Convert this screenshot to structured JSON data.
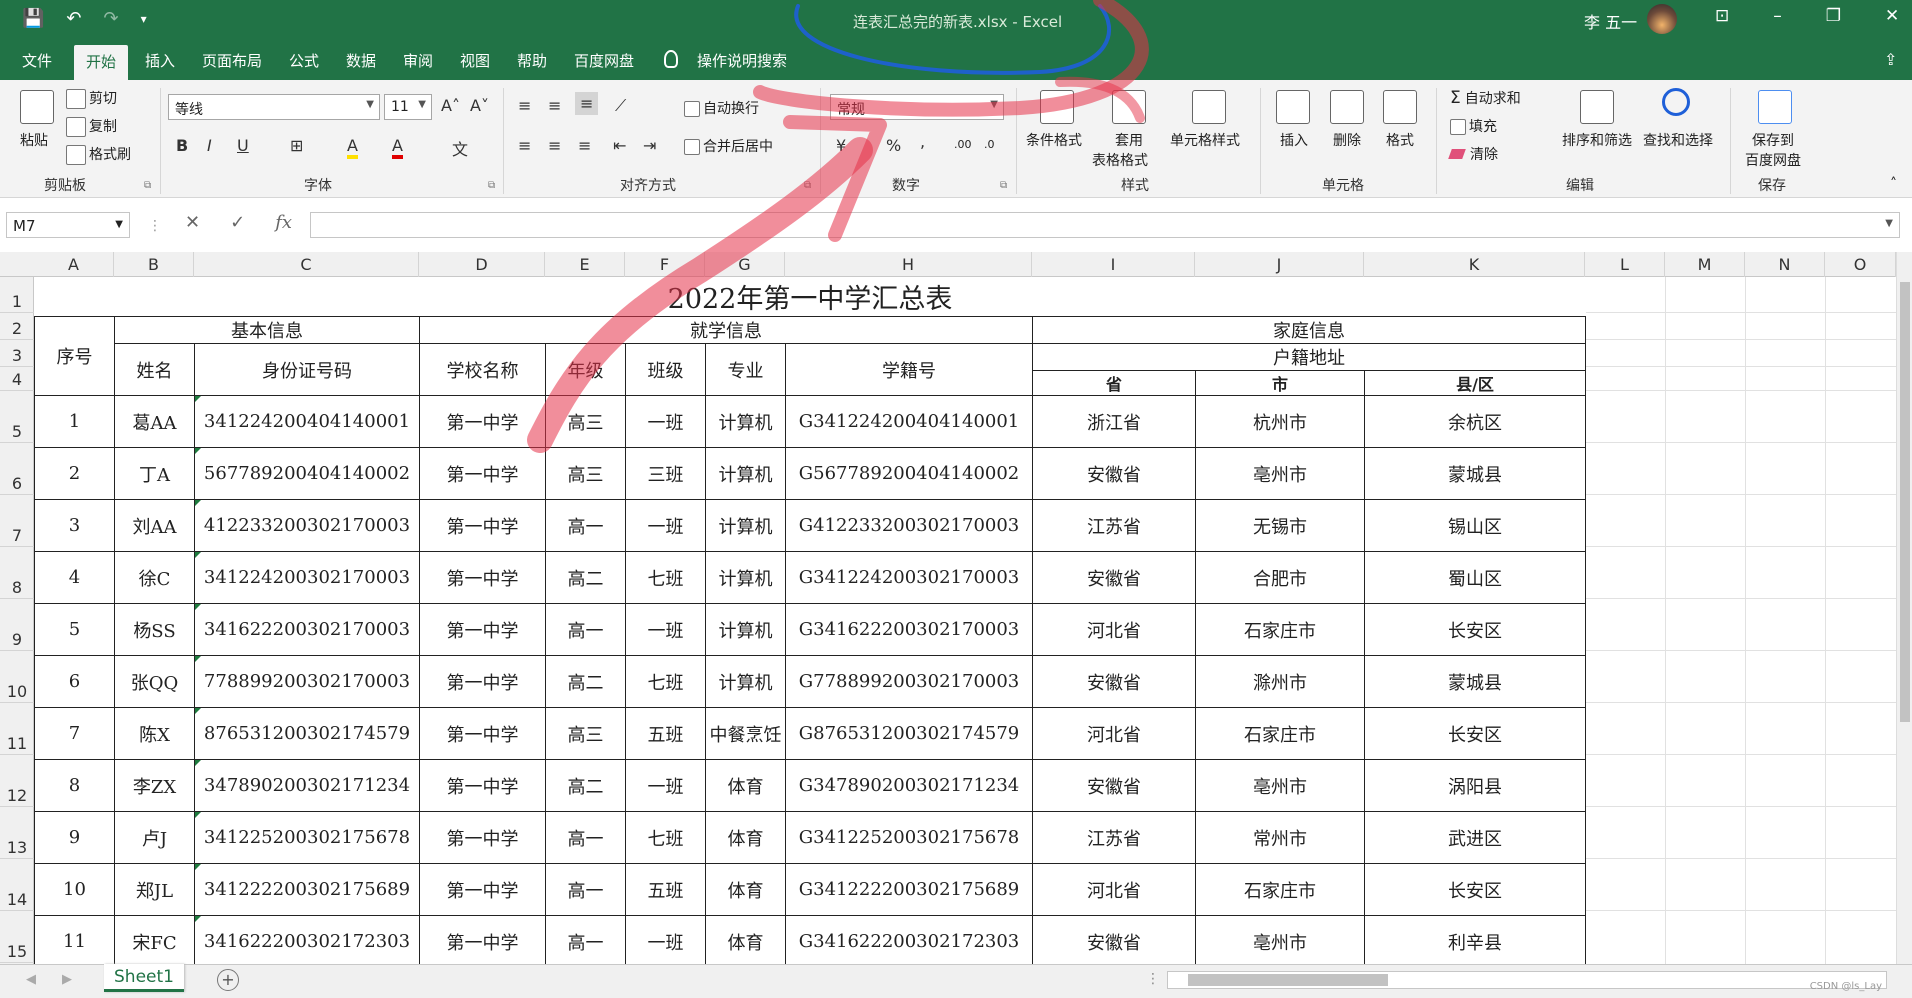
{
  "titlebar": {
    "qat": [
      "💾",
      "↶",
      "↷",
      "▾"
    ],
    "document_title": "连表汇总完的新表.xlsx - Excel",
    "user_name": "李 五一",
    "win_buttons": [
      "⊡",
      "–",
      "❐",
      "✕"
    ]
  },
  "ribbon_tabs": [
    "文件",
    "开始",
    "插入",
    "页面布局",
    "公式",
    "数据",
    "审阅",
    "视图",
    "帮助",
    "百度网盘"
  ],
  "active_tab": "开始",
  "search_hint": "操作说明搜索",
  "share_label": "⇪",
  "clipboard": {
    "paste": "粘贴",
    "cut": "剪切",
    "copy": "复制",
    "format_painter": "格式刷",
    "label": "剪贴板"
  },
  "font": {
    "name": "等线",
    "size": "11",
    "grow": "A˄",
    "shrink": "A˅",
    "bold": "B",
    "italic": "I",
    "underline": "U",
    "border": "⊞",
    "fill": "A",
    "color": "A",
    "wen": "文",
    "label": "字体"
  },
  "alignment": {
    "wrap": "自动换行",
    "merge": "合并后居中",
    "label": "对齐方式"
  },
  "number": {
    "format": "常规",
    "percent": "%",
    "comma": ",",
    "inc": ".00",
    "dec": ".0",
    "label": "数字"
  },
  "styles": {
    "conditional": "条件格式",
    "table_fmt_1": "套用",
    "table_fmt_2": "表格格式",
    "cell_styles": "单元格样式",
    "label": "样式"
  },
  "cells": {
    "insert": "插入",
    "delete": "删除",
    "format": "格式",
    "label": "单元格"
  },
  "editing": {
    "autosum": "自动求和",
    "fill": "填充",
    "clear": "清除",
    "sort": "排序和筛选",
    "find": "查找和选择",
    "label": "编辑"
  },
  "save": {
    "line1": "保存到",
    "line2": "百度网盘",
    "label": "保存"
  },
  "formula_bar": {
    "name_box": "M7",
    "fx": "fx",
    "cancel": "✕",
    "confirm": "✓",
    "content": ""
  },
  "columns": [
    "A",
    "B",
    "C",
    "D",
    "E",
    "F",
    "G",
    "H",
    "I",
    "J",
    "K",
    "L",
    "M",
    "N",
    "O"
  ],
  "rows": [
    "1",
    "2",
    "3",
    "4",
    "5",
    "6",
    "7",
    "8",
    "9",
    "10",
    "11",
    "12",
    "13",
    "14",
    "15"
  ],
  "sheet": {
    "title": "2022年第一中学汇总表",
    "group_basic": "基本信息",
    "group_school": "就学信息",
    "group_family": "家庭信息",
    "col_index": "序号",
    "col_name": "姓名",
    "col_id": "身份证号码",
    "col_school": "学校名称",
    "col_grade": "年级",
    "col_class": "班级",
    "col_major": "专业",
    "col_studentno": "学籍号",
    "col_hukou": "户籍地址",
    "col_province": "省",
    "col_city": "市",
    "col_county": "县/区",
    "records": [
      [
        "1",
        "葛AA",
        "341224200404140001",
        "第一中学",
        "高三",
        "一班",
        "计算机",
        "G341224200404140001",
        "浙江省",
        "杭州市",
        "余杭区"
      ],
      [
        "2",
        "丁A",
        "567789200404140002",
        "第一中学",
        "高三",
        "三班",
        "计算机",
        "G567789200404140002",
        "安徽省",
        "亳州市",
        "蒙城县"
      ],
      [
        "3",
        "刘AA",
        "412233200302170003",
        "第一中学",
        "高一",
        "一班",
        "计算机",
        "G412233200302170003",
        "江苏省",
        "无锡市",
        "锡山区"
      ],
      [
        "4",
        "徐C",
        "341224200302170003",
        "第一中学",
        "高二",
        "七班",
        "计算机",
        "G341224200302170003",
        "安徽省",
        "合肥市",
        "蜀山区"
      ],
      [
        "5",
        "杨SS",
        "341622200302170003",
        "第一中学",
        "高一",
        "一班",
        "计算机",
        "G341622200302170003",
        "河北省",
        "石家庄市",
        "长安区"
      ],
      [
        "6",
        "张QQ",
        "778899200302170003",
        "第一中学",
        "高二",
        "七班",
        "计算机",
        "G778899200302170003",
        "安徽省",
        "滁州市",
        "蒙城县"
      ],
      [
        "7",
        "陈X",
        "876531200302174579",
        "第一中学",
        "高三",
        "五班",
        "中餐烹饪",
        "G876531200302174579",
        "河北省",
        "石家庄市",
        "长安区"
      ],
      [
        "8",
        "李ZX",
        "347890200302171234",
        "第一中学",
        "高二",
        "一班",
        "体育",
        "G347890200302171234",
        "安徽省",
        "亳州市",
        "涡阳县"
      ],
      [
        "9",
        "卢J",
        "341225200302175678",
        "第一中学",
        "高一",
        "七班",
        "体育",
        "G341225200302175678",
        "江苏省",
        "常州市",
        "武进区"
      ],
      [
        "10",
        "郑JL",
        "341222200302175689",
        "第一中学",
        "高一",
        "五班",
        "体育",
        "G341222200302175689",
        "河北省",
        "石家庄市",
        "长安区"
      ],
      [
        "11",
        "宋FC",
        "341622200302172303",
        "第一中学",
        "高一",
        "一班",
        "体育",
        "G341622200302172303",
        "安徽省",
        "亳州市",
        "利辛县"
      ]
    ]
  },
  "sheet_tab": "Sheet1",
  "add_sheet": "+",
  "watermark": "CSDN @ls_Lay",
  "colors": {
    "excel_green": "#217346",
    "ink_red": "#e63248",
    "ink_blue": "#1e5fd8"
  }
}
